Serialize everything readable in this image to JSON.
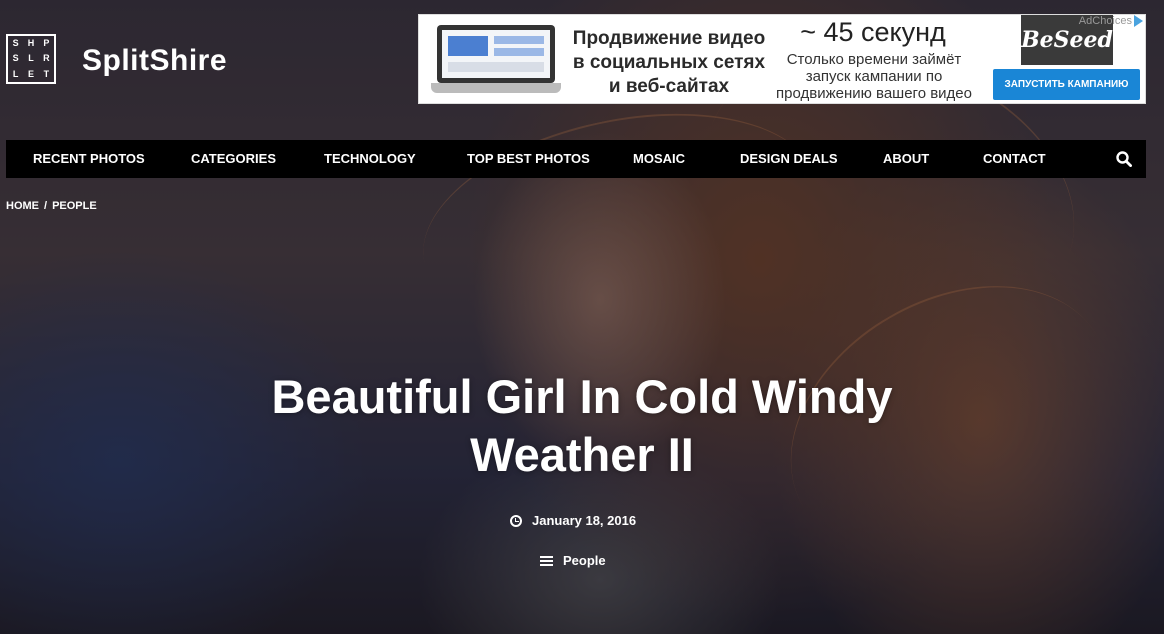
{
  "logo": {
    "letters": [
      "S",
      "H",
      "P",
      "S",
      "L",
      "R",
      "L",
      "E",
      "T"
    ],
    "name": "SplitShire"
  },
  "ad": {
    "headline": "Продвижение видео в социальных сетях и веб-сайтах",
    "timer": "~ 45 секунд",
    "subtext": "Столько времени займёт запуск кампании по продвижению вашего видео",
    "brand": "BeSeed",
    "cta": "ЗАПУСТИТЬ КАМПАНИЮ",
    "choices": "AdChoices"
  },
  "nav": {
    "items": [
      {
        "label": "RECENT PHOTOS"
      },
      {
        "label": "CATEGORIES"
      },
      {
        "label": "TECHNOLOGY"
      },
      {
        "label": "TOP BEST PHOTOS"
      },
      {
        "label": "MOSAIC"
      },
      {
        "label": "DESIGN DEALS"
      },
      {
        "label": "ABOUT"
      },
      {
        "label": "CONTACT"
      }
    ],
    "search_icon": "search-icon"
  },
  "breadcrumb": {
    "home": "HOME",
    "separator": "/",
    "current": "PEOPLE"
  },
  "post": {
    "title_line1": "Beautiful Girl In Cold Windy",
    "title_line2": "Weather II",
    "date": "January 18, 2016",
    "category": "People"
  }
}
